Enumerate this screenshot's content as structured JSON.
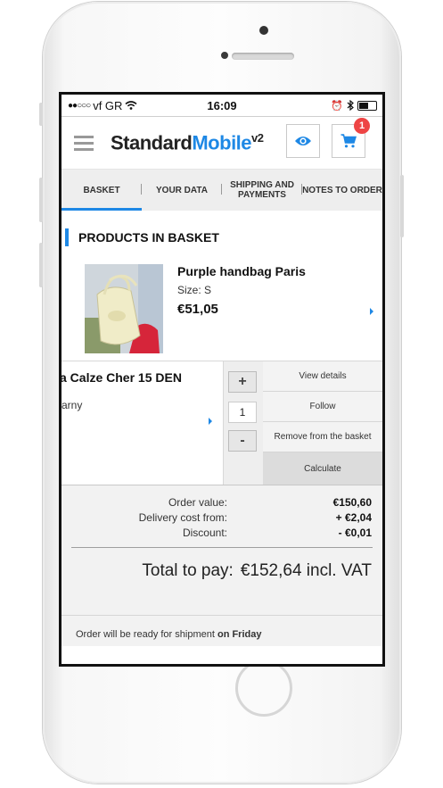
{
  "status_bar": {
    "carrier": "vf GR",
    "time": "16:09"
  },
  "header": {
    "logo_main": "Standard",
    "logo_accent": "Mobile",
    "logo_version": "v2",
    "cart_count": "1",
    "brand_color": "#1e88e5"
  },
  "tabs": [
    {
      "label": "BASKET",
      "active": true
    },
    {
      "label": "YOUR DATA",
      "active": false
    },
    {
      "label": "SHIPPING AND PAYMENTS",
      "active": false
    },
    {
      "label": "NOTES TO ORDER",
      "active": false
    }
  ],
  "section_title": "PRODUCTS IN BASKET",
  "products": [
    {
      "name": "Purple handbag Paris",
      "size": "Size: S",
      "price": "€51,05"
    },
    {
      "name": "a Calze Cher 15 DEN",
      "subtitle": "arny",
      "quantity": "1"
    }
  ],
  "quantity_controls": {
    "plus": "+",
    "minus": "-"
  },
  "actions": {
    "view": "View details",
    "follow": "Follow",
    "remove": "Remove from the basket",
    "calculate": "Calculate"
  },
  "summary": {
    "order_value_label": "Order value:",
    "order_value": "€150,60",
    "delivery_label": "Delivery cost from:",
    "delivery": "+ €2,04",
    "discount_label": "Discount:",
    "discount": "- €0,01",
    "total_label": "Total to pay:",
    "total": "€152,64 incl. VAT"
  },
  "shipment": {
    "text": "Order will be ready for shipment",
    "day": "on Friday"
  }
}
